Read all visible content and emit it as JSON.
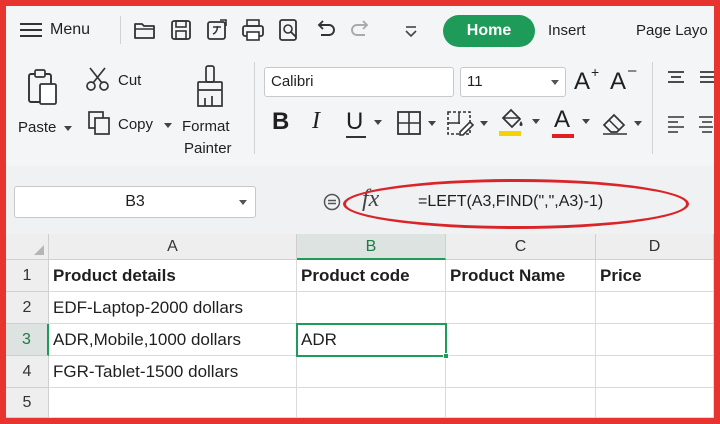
{
  "app": {
    "menu_label": "Menu",
    "tabs": [
      {
        "label": "Home",
        "active": true
      },
      {
        "label": "Insert",
        "active": false
      },
      {
        "label": "Page Layo",
        "active": false
      }
    ],
    "accent_color": "#1e9b58",
    "annotation_color": "#d9252a"
  },
  "quick_access": [
    "open-folder-icon",
    "save-icon",
    "export-pdf-icon",
    "print-icon",
    "print-preview-icon",
    "undo-icon",
    "redo-icon",
    "customize-dropdown-icon"
  ],
  "ribbon": {
    "paste_label": "Paste",
    "cut_label": "Cut",
    "copy_label": "Copy",
    "format_painter_line1": "Format",
    "format_painter_line2": "Painter",
    "font_name": "Calibri",
    "font_size": "11",
    "font_buttons": [
      "increase-font-size-icon",
      "decrease-font-size-icon",
      "bold-icon",
      "italic-icon",
      "underline-icon",
      "borders-icon",
      "fill-style-icon",
      "fill-color-icon",
      "font-color-icon",
      "clear-format-icon"
    ],
    "bold_glyph": "B",
    "italic_glyph": "I",
    "underline_glyph": "U",
    "font_color_glyph": "A",
    "grow_glyph": "A",
    "shrink_glyph": "A"
  },
  "formula_bar": {
    "name_box": "B3",
    "fx_label": "fx",
    "formula": "=LEFT(A3,FIND(\",\",A3)-1)"
  },
  "sheet": {
    "columns": [
      "A",
      "B",
      "C",
      "D"
    ],
    "rows": [
      "1",
      "2",
      "3",
      "4",
      "5"
    ],
    "cells": {
      "A1": "Product details",
      "B1": "Product code",
      "C1": "Product Name",
      "D1": "Price",
      "A2": "EDF-Laptop-2000 dollars",
      "A3": "ADR,Mobile,1000 dollars",
      "B3": "ADR",
      "A4": "FGR-Tablet-1500 dollars"
    },
    "active_cell": "B3"
  }
}
